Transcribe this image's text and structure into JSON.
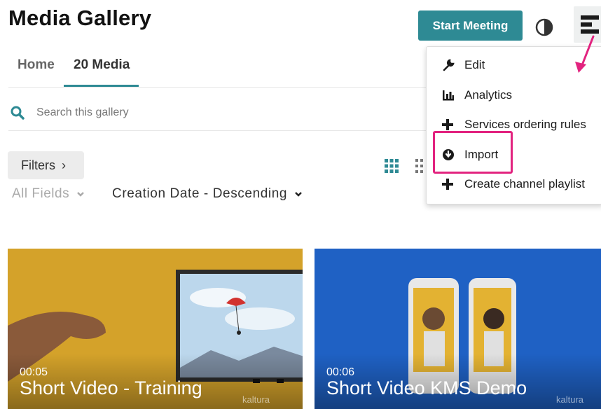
{
  "page": {
    "title": "Media Gallery"
  },
  "header": {
    "start_meeting_label": "Start Meeting"
  },
  "tabs": [
    {
      "label": "Home"
    },
    {
      "label": "20 Media"
    }
  ],
  "search": {
    "placeholder": "Search this gallery"
  },
  "filters": {
    "label": "Filters",
    "chevron": "›",
    "fields_label": "All Fields",
    "sort_label": "Creation Date - Descending"
  },
  "dropdown": {
    "items": [
      {
        "label": "Edit",
        "icon": "wrench-icon"
      },
      {
        "label": "Analytics",
        "icon": "bar-chart-icon"
      },
      {
        "label": "Services ordering rules",
        "icon": "plus-icon"
      },
      {
        "label": "Import",
        "icon": "import-icon"
      },
      {
        "label": "Create channel playlist",
        "icon": "plus-icon"
      }
    ]
  },
  "media": [
    {
      "duration": "00:05",
      "title": "Short Video - Training",
      "brand": "kaltura"
    },
    {
      "duration": "00:06",
      "title": "Short Video KMS Demo",
      "brand": "kaltura"
    }
  ],
  "colors": {
    "accent": "#2e8a94",
    "highlight": "#e2237f",
    "card1_bg": "#d4a22a",
    "card2_bg": "#1f61c4"
  }
}
